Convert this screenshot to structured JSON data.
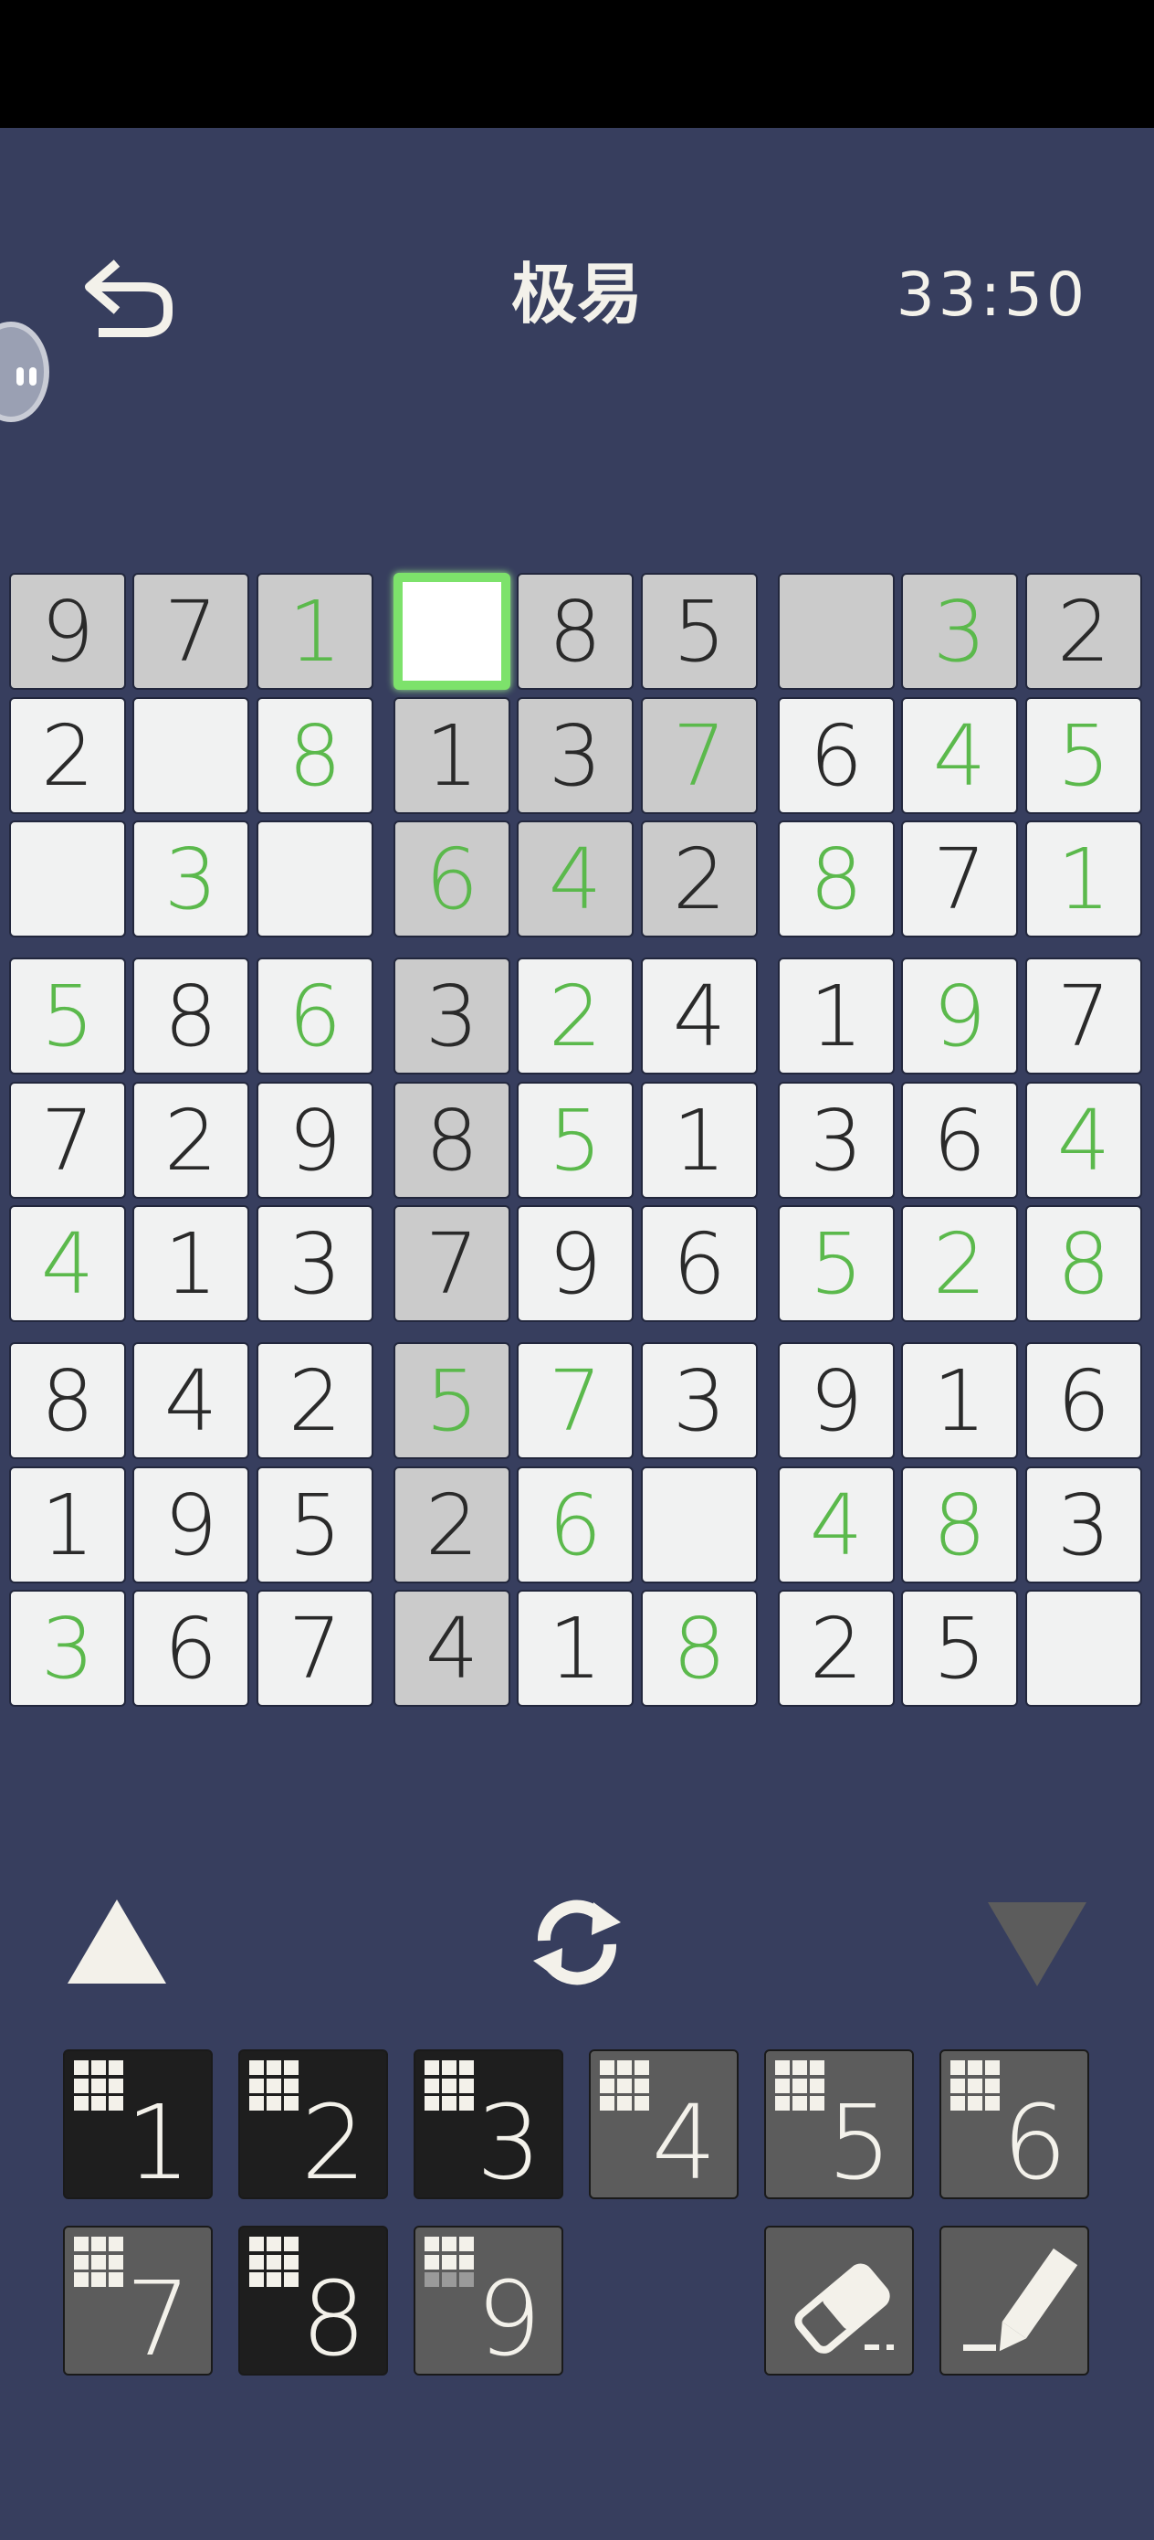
{
  "header": {
    "title": "极易",
    "timer": "33:50"
  },
  "grid": {
    "rows": [
      [
        "9",
        "7",
        "1",
        "",
        "8",
        "5",
        "",
        "3",
        "2"
      ],
      [
        "2",
        "",
        "8",
        "1",
        "3",
        "7",
        "6",
        "4",
        "5"
      ],
      [
        "",
        "3",
        "",
        "6",
        "4",
        "2",
        "8",
        "7",
        "1"
      ],
      [
        "5",
        "8",
        "6",
        "3",
        "2",
        "4",
        "1",
        "9",
        "7"
      ],
      [
        "7",
        "2",
        "9",
        "8",
        "5",
        "1",
        "3",
        "6",
        "4"
      ],
      [
        "4",
        "1",
        "3",
        "7",
        "9",
        "6",
        "5",
        "2",
        "8"
      ],
      [
        "8",
        "4",
        "2",
        "5",
        "7",
        "3",
        "9",
        "1",
        "6"
      ],
      [
        "1",
        "9",
        "5",
        "2",
        "6",
        "",
        "4",
        "8",
        "3"
      ],
      [
        "3",
        "6",
        "7",
        "4",
        "1",
        "8",
        "2",
        "5",
        ""
      ]
    ],
    "user_entered": [
      [
        0,
        0,
        1,
        0,
        0,
        0,
        0,
        1,
        0
      ],
      [
        0,
        0,
        1,
        0,
        0,
        1,
        0,
        1,
        1
      ],
      [
        0,
        1,
        0,
        1,
        1,
        0,
        1,
        0,
        1
      ],
      [
        1,
        0,
        1,
        0,
        1,
        0,
        0,
        1,
        0
      ],
      [
        0,
        0,
        0,
        0,
        1,
        0,
        0,
        0,
        1
      ],
      [
        1,
        0,
        0,
        0,
        0,
        0,
        1,
        1,
        1
      ],
      [
        0,
        0,
        0,
        1,
        1,
        0,
        0,
        0,
        0
      ],
      [
        0,
        0,
        0,
        0,
        1,
        0,
        1,
        1,
        0
      ],
      [
        1,
        0,
        0,
        0,
        0,
        1,
        0,
        0,
        0
      ]
    ],
    "highlighted": [
      [
        1,
        1,
        1,
        0,
        1,
        1,
        1,
        1,
        1
      ],
      [
        0,
        0,
        0,
        1,
        1,
        1,
        0,
        0,
        0
      ],
      [
        0,
        0,
        0,
        1,
        1,
        1,
        0,
        0,
        0
      ],
      [
        0,
        0,
        0,
        1,
        0,
        0,
        0,
        0,
        0
      ],
      [
        0,
        0,
        0,
        1,
        0,
        0,
        0,
        0,
        0
      ],
      [
        0,
        0,
        0,
        1,
        0,
        0,
        0,
        0,
        0
      ],
      [
        0,
        0,
        0,
        1,
        0,
        0,
        0,
        0,
        0
      ],
      [
        0,
        0,
        0,
        1,
        0,
        0,
        0,
        0,
        0
      ],
      [
        0,
        0,
        0,
        1,
        0,
        0,
        0,
        0,
        0
      ]
    ],
    "selected": {
      "row": 0,
      "col": 3
    }
  },
  "keypad": {
    "keys": [
      {
        "label": "1",
        "style": "dark",
        "mini_off": []
      },
      {
        "label": "2",
        "style": "dark",
        "mini_off": []
      },
      {
        "label": "3",
        "style": "dark",
        "mini_off": []
      },
      {
        "label": "4",
        "style": "grey",
        "mini_off": []
      },
      {
        "label": "5",
        "style": "grey",
        "mini_off": []
      },
      {
        "label": "6",
        "style": "grey",
        "mini_off": []
      },
      {
        "label": "7",
        "style": "grey",
        "mini_off": []
      },
      {
        "label": "8",
        "style": "dark",
        "mini_off": []
      },
      {
        "label": "9",
        "style": "grey",
        "mini_off": [
          6,
          7,
          8
        ]
      }
    ]
  },
  "icons": {
    "back": "back-arrow-icon",
    "up": "triangle-up-icon",
    "refresh": "refresh-icon",
    "down": "triangle-down-icon",
    "eraser": "eraser-icon",
    "pencil": "pencil-icon"
  },
  "colors": {
    "background": "#373e5e",
    "given": "#2a2a2a",
    "user": "#5bb94c",
    "selected_border": "#7de26b"
  }
}
